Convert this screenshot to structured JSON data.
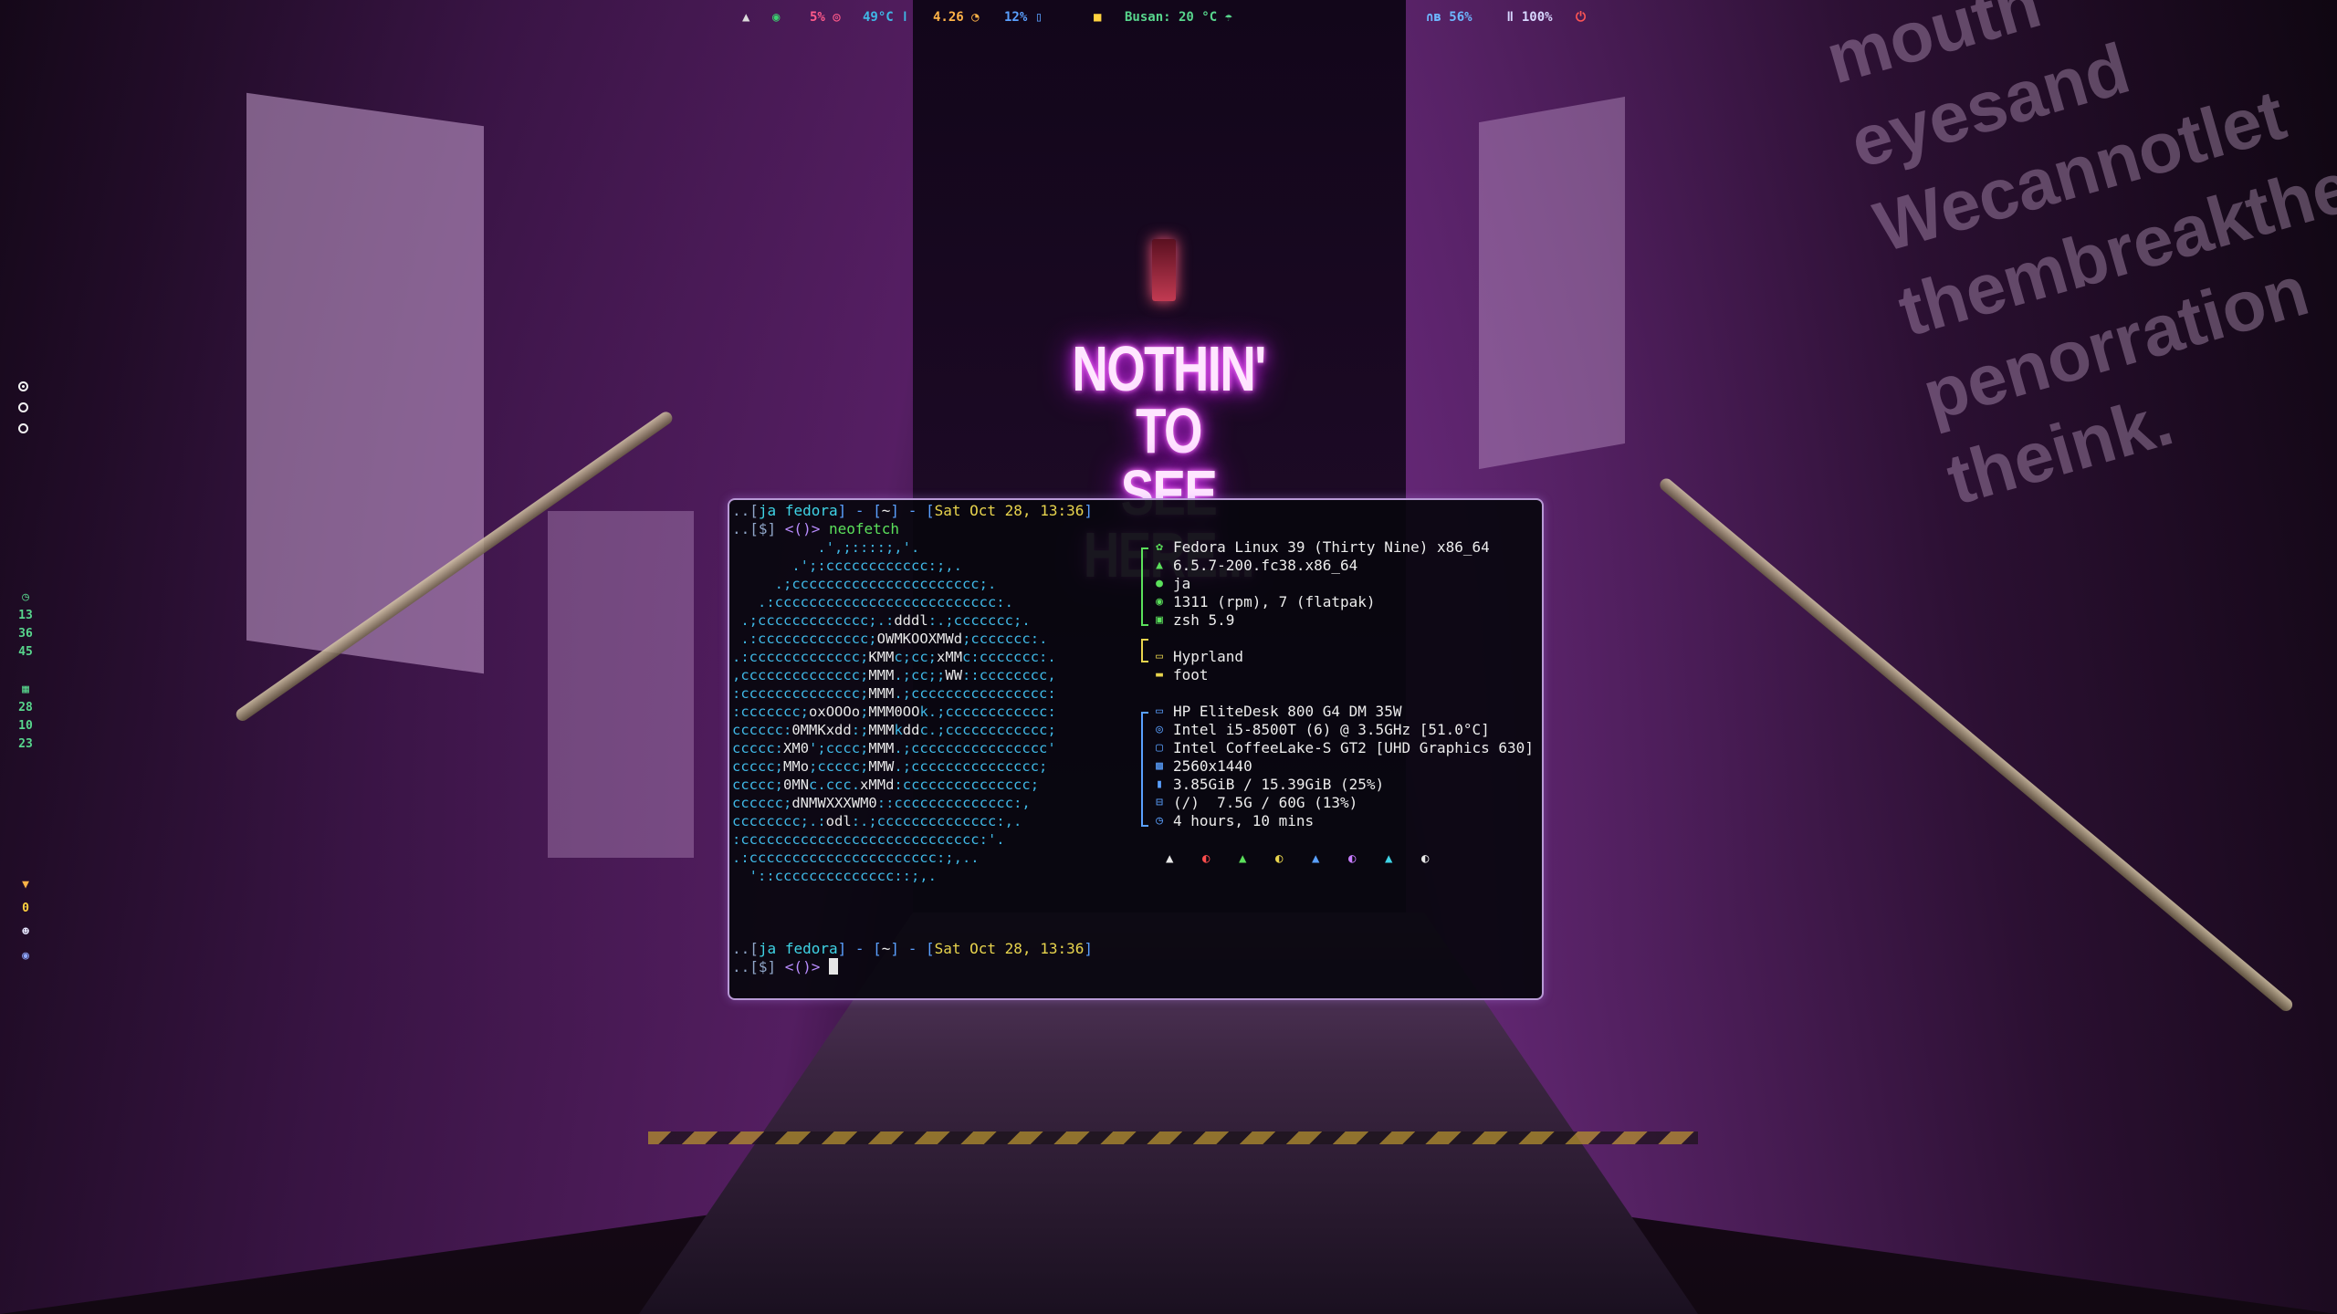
{
  "wallpaper": {
    "neon_line1": "NOTHIN' TO",
    "neon_line2": "SEE HERE...",
    "graffiti_right": [
      "mouth",
      "eyesand",
      "Wecannotlet",
      "thembreakthe",
      "penorration",
      "theink."
    ]
  },
  "topbar": {
    "left_icon": "fedora-icon",
    "eye_icon": "eye-icon",
    "cpu_percent": "5%",
    "cpu_icon": "cpu-icon",
    "temp": "49°C",
    "temp_icon": "thermometer-icon",
    "load": "4.26",
    "load_icon": "gauge-icon",
    "disk": "12%",
    "disk_icon": "disk-icon",
    "lock_icon": "lock-icon",
    "weather": "Busan: 20 °C",
    "weather_icon": "weather-icon",
    "audio_icon": "headphones-bluetooth-icon",
    "volume": "56%",
    "mic_icon": "microphone-icon",
    "mic_level": "100%",
    "power_icon": "power-icon",
    "colors": {
      "fedora": "#dcdcdc",
      "eye": "#3bd16f",
      "cpu": "#ff5a8a",
      "temp": "#3fb8e6",
      "load": "#ffb347",
      "disk": "#5aa0ff",
      "lock": "#ffd23f",
      "weather": "#58d68d",
      "audio": "#6db7ff",
      "mic": "#d7d7ff",
      "power": "#ff5555"
    }
  },
  "leftbar": {
    "workspaces": [
      {
        "name": "workspace-1",
        "active": true
      },
      {
        "name": "workspace-2",
        "active": false
      },
      {
        "name": "workspace-3",
        "active": false
      }
    ],
    "clock_icon": "clock-icon",
    "time": [
      "13",
      "36",
      "45"
    ],
    "calendar_icon": "calendar-icon",
    "date": [
      "28",
      "10",
      "23"
    ],
    "notify_icon": "notification-icon",
    "notify_count": "0",
    "discord_icon": "discord-icon",
    "settings_icon": "settings-icon"
  },
  "terminal": {
    "prompt1": {
      "prefix": "..[",
      "user": "ja",
      "host": "fedora",
      "mid": "] - [",
      "dir": "~",
      "mid2": "] - [",
      "datetime": "Sat Oct 28, 13:36",
      "end": "]"
    },
    "prompt2_prefix": "..[$] ",
    "prompt2_sym": "<()>",
    "command": "neofetch",
    "ascii_logo": [
      "          .',;::::;,'.",
      "       .';:cccccccccccc:;,.",
      "     .;cccccccccccccccccccccc;.",
      "   .:cccccccccccccccccccccccccc:.",
      " .;ccccccccccccc;.:dddl:.;ccccccc;.",
      " .:ccccccccccccc;OWMKOOXMWd;ccccccc:.",
      ".:ccccccccccccc;KMMc;cc;xMMc:ccccccc:.",
      ",cccccccccccccc;MMM.;cc;;WW::cccccccc,",
      ":cccccccccccccc;MMM.;cccccccccccccccc:",
      ":ccccccc;oxOOOo;MMM0OOk.;cccccccccccc:",
      "cccccc:0MMKxdd:;MMMkddc.;cccccccccccc;",
      "ccccc:XM0';cccc;MMM.;cccccccccccccccc'",
      "ccccc;MMo;ccccc;MMW.;ccccccccccccccc;",
      "ccccc;0MNc.ccc.xMMd:ccccccccccccccc;",
      "cccccc;dNMWXXXWM0::cccccccccccccc:,",
      "cccccccc;.:odl:.;cccccccccccccc:,.",
      ":cccccccccccccccccccccccccccc:'.",
      ".:cccccccccccccccccccccc:;,..",
      "  '::cccccccccccccc::;,."
    ],
    "info": [
      {
        "icon": "fedora-icon",
        "glyph": "✿",
        "color": "#5be05b",
        "value": "Fedora Linux 39 (Thirty Nine) x86_64"
      },
      {
        "icon": "linux-icon",
        "glyph": "▲",
        "color": "#5be05b",
        "value": "6.5.7-200.fc38.x86_64"
      },
      {
        "icon": "user-icon",
        "glyph": "●",
        "color": "#5be05b",
        "value": "ja"
      },
      {
        "icon": "package-icon",
        "glyph": "◉",
        "color": "#5be05b",
        "value": "1311 (rpm), 7 (flatpak)"
      },
      {
        "icon": "shell-icon",
        "glyph": "▣",
        "color": "#5be05b",
        "value": "zsh 5.9"
      },
      {
        "icon": "window-manager-icon",
        "glyph": "▭",
        "color": "#e8d44d",
        "value": "Hyprland"
      },
      {
        "icon": "terminal-icon",
        "glyph": "▬",
        "color": "#e8d44d",
        "value": "foot"
      },
      {
        "icon": "computer-icon",
        "glyph": "▭",
        "color": "#5aa0ff",
        "value": "HP EliteDesk 800 G4 DM 35W"
      },
      {
        "icon": "cpu-icon",
        "glyph": "◎",
        "color": "#5aa0ff",
        "value": "Intel i5-8500T (6) @ 3.5GHz [51.0°C]"
      },
      {
        "icon": "gpu-icon",
        "glyph": "▢",
        "color": "#5aa0ff",
        "value": "Intel CoffeeLake-S GT2 [UHD Graphics 630]"
      },
      {
        "icon": "display-icon",
        "glyph": "▩",
        "color": "#5aa0ff",
        "value": "2560x1440"
      },
      {
        "icon": "memory-icon",
        "glyph": "▮",
        "color": "#5aa0ff",
        "value": "3.85GiB / 15.39GiB (25%)"
      },
      {
        "icon": "disk-icon",
        "glyph": "⊟",
        "color": "#5aa0ff",
        "value": "(/)  7.5G / 60G (13%)"
      },
      {
        "icon": "uptime-icon",
        "glyph": "◷",
        "color": "#5aa0ff",
        "value": "4 hours, 10 mins"
      }
    ],
    "color_blocks": [
      {
        "glyph": "▲",
        "color": "#e8e8e8"
      },
      {
        "glyph": "◐",
        "color": "#ff4d4d"
      },
      {
        "glyph": "▲",
        "color": "#5be05b"
      },
      {
        "glyph": "◐",
        "color": "#e8d44d"
      },
      {
        "glyph": "▲",
        "color": "#5aa0ff"
      },
      {
        "glyph": "◐",
        "color": "#c77dff"
      },
      {
        "glyph": "▲",
        "color": "#3fd4e6"
      },
      {
        "glyph": "◐",
        "color": "#e8e8e8"
      }
    ],
    "prompt3": {
      "prefix": "..[",
      "user": "ja",
      "host": "fedora",
      "mid": "] - [",
      "dir": "~",
      "mid2": "] - [",
      "datetime": "Sat Oct 28, 13:36",
      "end": "]"
    },
    "prompt4_prefix": "..[$] ",
    "prompt4_sym": "<()>"
  }
}
